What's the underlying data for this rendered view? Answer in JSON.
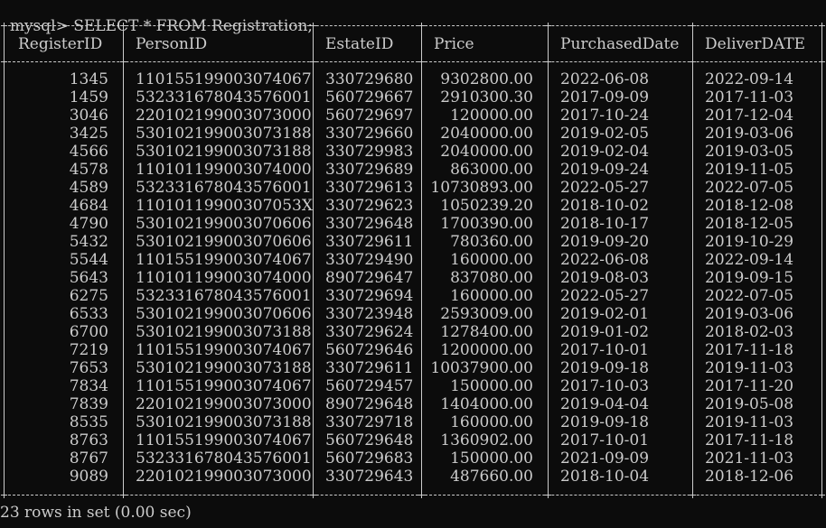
{
  "terminal": {
    "prompt": "mysql>",
    "command": "SELECT * FROM Registration;",
    "footer": "23 rows in set (0.00 sec)"
  },
  "table": {
    "headers": [
      "RegisterID",
      "PersonID",
      "EstateID",
      "Price",
      "PurchasedDate",
      "DeliverDATE"
    ],
    "rows": [
      [
        "1345",
        "110155199003074067",
        "330729680",
        "9302800.00",
        "2022-06-08",
        "2022-09-14"
      ],
      [
        "1459",
        "532331678043576001",
        "560729667",
        "2910300.30",
        "2017-09-09",
        "2017-11-03"
      ],
      [
        "3046",
        "220102199003073000",
        "560729697",
        "120000.00",
        "2017-10-24",
        "2017-12-04"
      ],
      [
        "3425",
        "530102199003073188",
        "330729660",
        "2040000.00",
        "2019-02-05",
        "2019-03-06"
      ],
      [
        "4566",
        "530102199003073188",
        "330729983",
        "2040000.00",
        "2019-02-04",
        "2019-03-05"
      ],
      [
        "4578",
        "110101199003074000",
        "330729689",
        "863000.00",
        "2019-09-24",
        "2019-11-05"
      ],
      [
        "4589",
        "532331678043576001",
        "330729613",
        "10730893.00",
        "2022-05-27",
        "2022-07-05"
      ],
      [
        "4684",
        "11010119900307053X",
        "330729623",
        "1050239.20",
        "2018-10-02",
        "2018-12-08"
      ],
      [
        "4790",
        "530102199003070606",
        "330729648",
        "1700390.00",
        "2018-10-17",
        "2018-12-05"
      ],
      [
        "5432",
        "530102199003070606",
        "330729611",
        "780360.00",
        "2019-09-20",
        "2019-10-29"
      ],
      [
        "5544",
        "110155199003074067",
        "330729490",
        "160000.00",
        "2022-06-08",
        "2022-09-14"
      ],
      [
        "5643",
        "110101199003074000",
        "890729647",
        "837080.00",
        "2019-08-03",
        "2019-09-15"
      ],
      [
        "6275",
        "532331678043576001",
        "330729694",
        "160000.00",
        "2022-05-27",
        "2022-07-05"
      ],
      [
        "6533",
        "530102199003070606",
        "330723948",
        "2593009.00",
        "2019-02-01",
        "2019-03-06"
      ],
      [
        "6700",
        "530102199003073188",
        "330729624",
        "1278400.00",
        "2019-01-02",
        "2018-02-03"
      ],
      [
        "7219",
        "110155199003074067",
        "560729646",
        "1200000.00",
        "2017-10-01",
        "2017-11-18"
      ],
      [
        "7653",
        "530102199003073188",
        "330729611",
        "10037900.00",
        "2019-09-18",
        "2019-11-03"
      ],
      [
        "7834",
        "110155199003074067",
        "560729457",
        "150000.00",
        "2017-10-03",
        "2017-11-20"
      ],
      [
        "7839",
        "220102199003073000",
        "890729648",
        "1404000.00",
        "2019-04-04",
        "2019-05-08"
      ],
      [
        "8535",
        "530102199003073188",
        "330729718",
        "160000.00",
        "2019-09-18",
        "2019-11-03"
      ],
      [
        "8763",
        "110155199003074067",
        "560729648",
        "1360902.00",
        "2017-10-01",
        "2017-11-18"
      ],
      [
        "8767",
        "532331678043576001",
        "560729683",
        "150000.00",
        "2021-09-09",
        "2021-11-03"
      ],
      [
        "9089",
        "220102199003073000",
        "330729643",
        "487660.00",
        "2018-10-04",
        "2018-12-06"
      ]
    ]
  }
}
